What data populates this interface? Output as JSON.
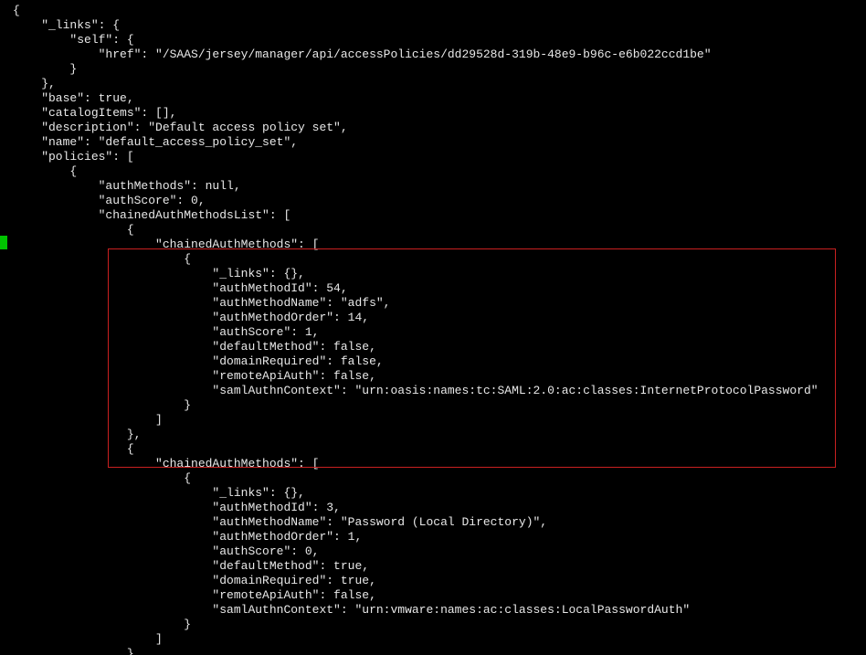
{
  "lines": [
    "{",
    "    \"_links\": {",
    "        \"self\": {",
    "            \"href\": \"/SAAS/jersey/manager/api/accessPolicies/dd29528d-319b-48e9-b96c-e6b022ccd1be\"",
    "        }",
    "    },",
    "    \"base\": true,",
    "    \"catalogItems\": [],",
    "    \"description\": \"Default access policy set\",",
    "    \"name\": \"default_access_policy_set\",",
    "    \"policies\": [",
    "        {",
    "            \"authMethods\": null,",
    "            \"authScore\": 0,",
    "            \"chainedAuthMethodsList\": [",
    "                {",
    "                    \"chainedAuthMethods\": [",
    "                        {",
    "                            \"_links\": {},",
    "                            \"authMethodId\": 54,",
    "                            \"authMethodName\": \"adfs\",",
    "                            \"authMethodOrder\": 14,",
    "                            \"authScore\": 1,",
    "                            \"defaultMethod\": false,",
    "                            \"domainRequired\": false,",
    "                            \"remoteApiAuth\": false,",
    "                            \"samlAuthnContext\": \"urn:oasis:names:tc:SAML:2.0:ac:classes:InternetProtocolPassword\"",
    "                        }",
    "                    ]",
    "                },",
    "                {",
    "                    \"chainedAuthMethods\": [",
    "                        {",
    "                            \"_links\": {},",
    "                            \"authMethodId\": 3,",
    "                            \"authMethodName\": \"Password (Local Directory)\",",
    "                            \"authMethodOrder\": 1,",
    "                            \"authScore\": 0,",
    "                            \"defaultMethod\": true,",
    "                            \"domainRequired\": true,",
    "                            \"remoteApiAuth\": false,",
    "                            \"samlAuthnContext\": \"urn:vmware:names:ac:classes:LocalPasswordAuth\"",
    "                        }",
    "                    ]",
    "                },"
  ],
  "json_payload": {
    "_links": {
      "self": {
        "href": "/SAAS/jersey/manager/api/accessPolicies/dd29528d-319b-48e9-b96c-e6b022ccd1be"
      }
    },
    "base": true,
    "catalogItems": [],
    "description": "Default access policy set",
    "name": "default_access_policy_set",
    "policies": [
      {
        "authMethods": null,
        "authScore": 0,
        "chainedAuthMethodsList": [
          {
            "chainedAuthMethods": [
              {
                "_links": {},
                "authMethodId": 54,
                "authMethodName": "adfs",
                "authMethodOrder": 14,
                "authScore": 1,
                "defaultMethod": false,
                "domainRequired": false,
                "remoteApiAuth": false,
                "samlAuthnContext": "urn:oasis:names:tc:SAML:2.0:ac:classes:InternetProtocolPassword"
              }
            ]
          },
          {
            "chainedAuthMethods": [
              {
                "_links": {},
                "authMethodId": 3,
                "authMethodName": "Password (Local Directory)",
                "authMethodOrder": 1,
                "authScore": 0,
                "defaultMethod": true,
                "domainRequired": true,
                "remoteApiAuth": false,
                "samlAuthnContext": "urn:vmware:names:ac:classes:LocalPasswordAuth"
              }
            ]
          }
        ]
      }
    ]
  }
}
